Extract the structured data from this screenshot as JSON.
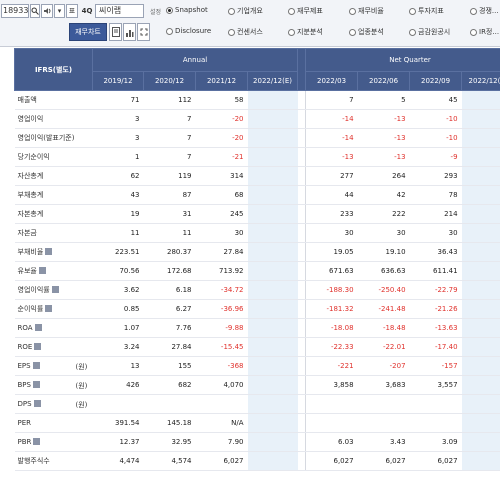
{
  "toolbar": {
    "code_value": "189330",
    "search_icon": "search-icon",
    "btn_label_1": "표",
    "btn_label_2": "4Q",
    "company_name": "씨이랩",
    "side_label": "설정",
    "report_button": "재무차트",
    "radios": [
      {
        "label": "Snapshot",
        "selected": true
      },
      {
        "label": "기업개요",
        "selected": false
      },
      {
        "label": "재무제표",
        "selected": false
      },
      {
        "label": "재무비율",
        "selected": false
      },
      {
        "label": "투자지표",
        "selected": false
      },
      {
        "label": "경쟁...",
        "selected": false
      },
      {
        "label": "Disclosure",
        "selected": false
      },
      {
        "label": "컨센서스",
        "selected": false
      },
      {
        "label": "지분분석",
        "selected": false
      },
      {
        "label": "업종분석",
        "selected": false
      },
      {
        "label": "금감원공시",
        "selected": false
      },
      {
        "label": "IR정...",
        "selected": false
      }
    ]
  },
  "table": {
    "corner_label": "IFRS(별도)",
    "group_annual": "Annual",
    "group_quarter": "Net Quarter",
    "annual_periods": [
      "2019/12",
      "2020/12",
      "2021/12",
      "2022/12(E)"
    ],
    "quarter_periods": [
      "2022/03",
      "2022/06",
      "2022/09",
      "2022/12(E)"
    ],
    "rows": [
      {
        "label": "매출액",
        "unit": "",
        "annual": [
          "71",
          "112",
          "58",
          ""
        ],
        "quarter": [
          "7",
          "5",
          "45",
          ""
        ]
      },
      {
        "label": "영업이익",
        "unit": "",
        "annual": [
          "3",
          "7",
          "-20",
          ""
        ],
        "quarter": [
          "-14",
          "-13",
          "-10",
          ""
        ]
      },
      {
        "label": "영업이익(발표기준)",
        "unit": "",
        "annual": [
          "3",
          "7",
          "-20",
          ""
        ],
        "quarter": [
          "-14",
          "-13",
          "-10",
          ""
        ]
      },
      {
        "label": "당기순이익",
        "unit": "",
        "annual": [
          "1",
          "7",
          "-21",
          ""
        ],
        "quarter": [
          "-13",
          "-13",
          "-9",
          ""
        ]
      },
      {
        "label": "자산총계",
        "unit": "",
        "annual": [
          "62",
          "119",
          "314",
          ""
        ],
        "quarter": [
          "277",
          "264",
          "293",
          ""
        ]
      },
      {
        "label": "부채총계",
        "unit": "",
        "annual": [
          "43",
          "87",
          "68",
          ""
        ],
        "quarter": [
          "44",
          "42",
          "78",
          ""
        ]
      },
      {
        "label": "자본총계",
        "unit": "",
        "annual": [
          "19",
          "31",
          "245",
          ""
        ],
        "quarter": [
          "233",
          "222",
          "214",
          ""
        ]
      },
      {
        "label": "자본금",
        "unit": "",
        "annual": [
          "11",
          "11",
          "30",
          ""
        ],
        "quarter": [
          "30",
          "30",
          "30",
          ""
        ]
      },
      {
        "label": "부채비율",
        "unit": "",
        "annual": [
          "223.51",
          "280.37",
          "27.84",
          ""
        ],
        "quarter": [
          "19.05",
          "19.10",
          "36.43",
          ""
        ]
      },
      {
        "label": "유보율",
        "unit": "",
        "annual": [
          "70.56",
          "172.68",
          "713.92",
          ""
        ],
        "quarter": [
          "671.63",
          "636.63",
          "611.41",
          ""
        ]
      },
      {
        "label": "영업이익률",
        "unit": "",
        "annual": [
          "3.62",
          "6.18",
          "-34.72",
          ""
        ],
        "quarter": [
          "-188.30",
          "-250.40",
          "-22.79",
          ""
        ]
      },
      {
        "label": "순이익률",
        "unit": "",
        "annual": [
          "0.85",
          "6.27",
          "-36.96",
          ""
        ],
        "quarter": [
          "-181.32",
          "-241.48",
          "-21.26",
          ""
        ]
      },
      {
        "label": "ROA",
        "unit": "",
        "annual": [
          "1.07",
          "7.76",
          "-9.88",
          ""
        ],
        "quarter": [
          "-18.08",
          "-18.48",
          "-13.63",
          ""
        ]
      },
      {
        "label": "ROE",
        "unit": "",
        "annual": [
          "3.24",
          "27.84",
          "-15.45",
          ""
        ],
        "quarter": [
          "-22.33",
          "-22.01",
          "-17.40",
          ""
        ]
      },
      {
        "label": "EPS",
        "unit": "(원)",
        "annual": [
          "13",
          "155",
          "-368",
          ""
        ],
        "quarter": [
          "-221",
          "-207",
          "-157",
          ""
        ]
      },
      {
        "label": "BPS",
        "unit": "(원)",
        "annual": [
          "426",
          "682",
          "4,070",
          ""
        ],
        "quarter": [
          "3,858",
          "3,683",
          "3,557",
          ""
        ]
      },
      {
        "label": "DPS",
        "unit": "(원)",
        "annual": [
          "",
          "",
          "",
          ""
        ],
        "quarter": [
          "",
          "",
          "",
          ""
        ]
      },
      {
        "label": "PER",
        "unit": "",
        "annual": [
          "391.54",
          "145.18",
          "N/A",
          ""
        ],
        "quarter": [
          "",
          "",
          "",
          ""
        ]
      },
      {
        "label": "PBR",
        "unit": "",
        "annual": [
          "12.37",
          "32.95",
          "7.90",
          ""
        ],
        "quarter": [
          "6.03",
          "3.43",
          "3.09",
          ""
        ]
      },
      {
        "label": "발행주식수",
        "unit": "",
        "annual": [
          "4,474",
          "4,574",
          "6,027",
          ""
        ],
        "quarter": [
          "6,027",
          "6,027",
          "6,027",
          ""
        ]
      }
    ],
    "icon_rows": [
      8,
      9,
      10,
      11,
      12,
      13,
      14,
      15,
      16,
      18
    ],
    "colors": {
      "header_bg": "#445b8c",
      "negative": "#e0322d",
      "estimate_bg": "#e8f1f9"
    }
  }
}
